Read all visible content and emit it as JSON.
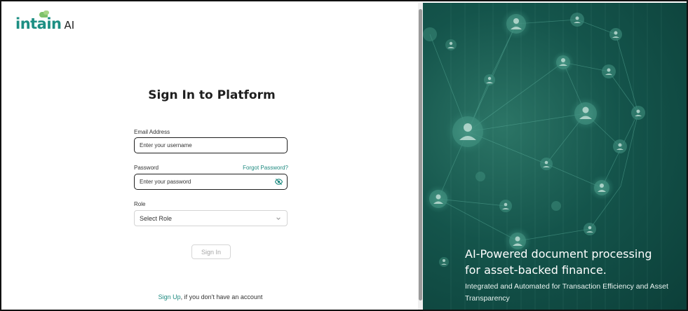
{
  "brand": {
    "logo_text": "intain",
    "logo_suffix": "AI",
    "accent_color": "#1f8a80"
  },
  "form": {
    "title": "Sign In to Platform",
    "email": {
      "label": "Email Address",
      "placeholder": "Enter your username"
    },
    "password": {
      "label": "Password",
      "placeholder": "Enter your password",
      "forgot_label": "Forgot Password?",
      "toggle_icon": "eye-off-icon"
    },
    "role": {
      "label": "Role",
      "selected": "Select Role",
      "icon": "chevron-down-icon"
    },
    "signin_label": "Sign In",
    "signup_link": "Sign Up",
    "signup_text": ", if you don't have an account"
  },
  "hero": {
    "heading_line1": "AI-Powered document processing",
    "heading_line2": "for asset-backed finance.",
    "subheading": "Integrated and Automated for Transaction Efficiency and Asset Transparency",
    "background_color": "#14544b",
    "graphic": "people-network-illustration"
  }
}
